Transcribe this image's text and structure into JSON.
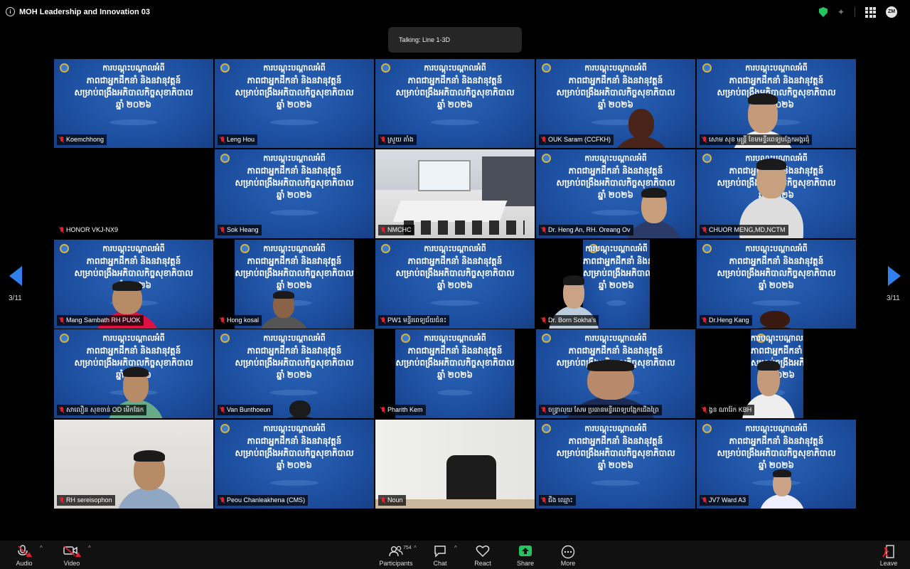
{
  "meeting": {
    "title": "MOH Leadership and Innovation 03",
    "talking": "Talking: Line 1-3D",
    "page_left": "3/11",
    "page_right": "3/11"
  },
  "colors": {
    "accent": "#2f80ed",
    "slide_blue": "#1d4fa0",
    "mic_muted": "#e0202e",
    "share_green": "#22c55e"
  },
  "slide_text": {
    "line1": "ការបណ្ដុះបណ្ដាលអំពី",
    "line2": "ភាពជាអ្នកដឹកនាំ និងនវានុវត្តន៍",
    "line3": "សម្រាប់ពង្រឹងអភិបាលកិច្ចសុខាភិបាល",
    "line4": "ឆ្នាំ ២០២៦"
  },
  "participants": [
    {
      "name": "Koemchhong"
    },
    {
      "name": "Leng Hou"
    },
    {
      "name": "ស្រួយ តាំង"
    },
    {
      "name": "OUK Saram (CCFKH)"
    },
    {
      "name": "សោម សុខ មន្ត្រី ខែមមន្ទីរពេទ្យបង្អែកអង្គរជុំ"
    },
    {
      "name": "HONOR VKJ-NX9"
    },
    {
      "name": "Sok Heang"
    },
    {
      "name": "NMCHC"
    },
    {
      "name": "Dr. Heng An, RH. Oreang Ov"
    },
    {
      "name": "CHUOR MENG,MD,NCTM"
    },
    {
      "name": "Mang Sambath RH PUOK"
    },
    {
      "name": "Hong kosal"
    },
    {
      "name": "PW1 មន្ទីរពេទ្យជ័យជំនះ"
    },
    {
      "name": "Dr. Born Sokha's"
    },
    {
      "name": "Dr.Heng Kang"
    },
    {
      "name": "សាលឿន សុខចាន់ OD មើកផែក"
    },
    {
      "name": "Van Bunthoeun"
    },
    {
      "name": "Pharith Kem"
    },
    {
      "name": "ចន្ទ្រាលុយ សែម ប្រធានមន្ទីរពេទ្យបង្អែកជើងព្រៃ"
    },
    {
      "name": "ង្វន ណារ៉ែក KBH"
    },
    {
      "name": "RH sereisophon"
    },
    {
      "name": "Peou Chanleakhena (CMS)"
    },
    {
      "name": "Noun"
    },
    {
      "name": "ជីង ឈ្មោះ"
    },
    {
      "name": "JV7 Ward A3"
    }
  ],
  "toolbar": {
    "audio": "Audio",
    "video": "Video",
    "participants": "Participants",
    "participant_count": "754",
    "chat": "Chat",
    "react": "React",
    "share": "Share",
    "more": "More",
    "leave": "Leave"
  }
}
